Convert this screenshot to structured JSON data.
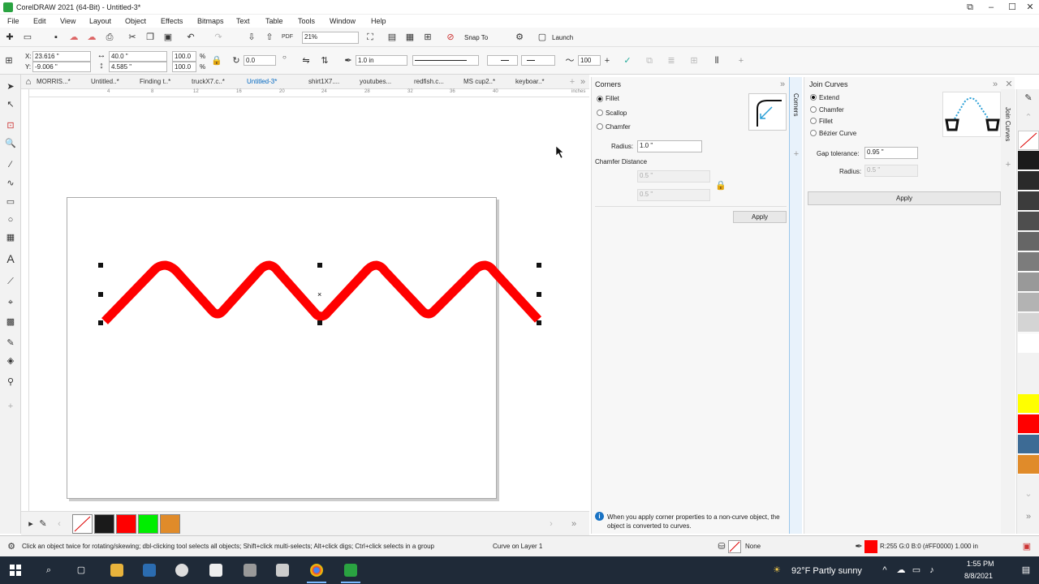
{
  "window": {
    "title": "CorelDRAW 2021 (64-Bit) - Untitled-3*"
  },
  "menu": [
    "File",
    "Edit",
    "View",
    "Layout",
    "Object",
    "Effects",
    "Bitmaps",
    "Text",
    "Table",
    "Tools",
    "Window",
    "Help"
  ],
  "toolbar": {
    "zoom": "21%",
    "snap_to": "Snap To",
    "launch": "Launch"
  },
  "propertybar": {
    "x": "23.616 \"",
    "y": "-9.006 \"",
    "w": "40.0 \"",
    "h": "4.585 \"",
    "scale_w": "100.0",
    "scale_h": "100.0",
    "pct": "%",
    "angle": "0.0",
    "outline_width": "1.0 in",
    "smoothing": "100"
  },
  "doc_tabs": [
    "MORRIS...*",
    "Untitled..*",
    "Finding t..*",
    "truckX7.c..*",
    "Untitled-3*",
    "shirt1X7....",
    "youtubes...",
    "redfish.c...",
    "MS cup2..*",
    "keyboar..*"
  ],
  "ruler": {
    "units": "inches",
    "ticks": [
      "4",
      "8",
      "12",
      "16",
      "20",
      "24",
      "28",
      "32",
      "36",
      "40"
    ]
  },
  "corners_panel": {
    "title": "Corners",
    "options": [
      "Fillet",
      "Scallop",
      "Chamfer"
    ],
    "selected": "Fillet",
    "radius_label": "Radius:",
    "radius_value": "1.0 \"",
    "chamfer_label": "Chamfer Distance",
    "chamfer_a": "0.5 \"",
    "chamfer_b": "0.5 \"",
    "apply": "Apply",
    "info": "When you apply corner properties to a non-curve object, the object is converted to curves.",
    "side_tab": "Corners"
  },
  "join_panel": {
    "title": "Join Curves",
    "options": [
      "Extend",
      "Chamfer",
      "Fillet",
      "Bézier Curve"
    ],
    "selected": "Extend",
    "gap_label": "Gap tolerance:",
    "gap_value": "0.95 \"",
    "radius_label": "Radius:",
    "radius_value": "0.5 \"",
    "apply": "Apply",
    "side_tab": "Join Curves"
  },
  "doc_palette": {
    "colors": [
      "#1a1a1a",
      "#ff0000",
      "#00ee00",
      "#e08b2a"
    ]
  },
  "color_palette": {
    "colors": [
      "#1b1b1b",
      "#2a2a2a",
      "#3c3c3c",
      "#4e4e4e",
      "#666666",
      "#7c7c7c",
      "#999999",
      "#b3b3b3",
      "#d4d4d4",
      "#ffffff",
      "#ffff00",
      "#ff0000",
      "#3d6b95",
      "#e08b2a"
    ]
  },
  "status": {
    "hint": "Click an object twice for rotating/skewing; dbl-clicking tool selects all objects; Shift+click multi-selects; Alt+click digs; Ctrl+click selects in a group",
    "object": "Curve on Layer 1",
    "fill": "None",
    "outline": "R:255 G:0 B:0 (#FF0000)  1.000 in",
    "accent": "#ff0000"
  },
  "taskbar": {
    "weather": "92°F  Partly sunny",
    "time": "1:55 PM",
    "date": "8/8/2021"
  }
}
